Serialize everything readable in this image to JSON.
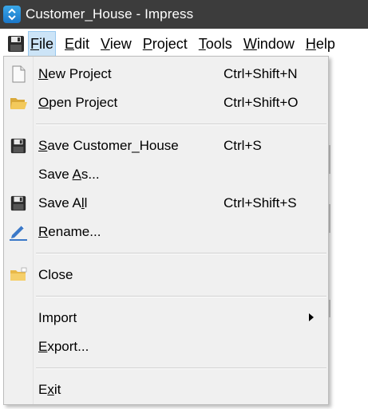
{
  "window": {
    "title": "Customer_House - Impress",
    "app_icon": "impress-app-icon"
  },
  "menubar": {
    "toolbar_icon": "save-icon",
    "items": [
      {
        "label": "File",
        "mnemonic": "F",
        "rest": "ile",
        "active": true
      },
      {
        "label": "Edit",
        "mnemonic": "E",
        "rest": "dit"
      },
      {
        "label": "View",
        "mnemonic": "V",
        "rest": "iew"
      },
      {
        "label": "Project",
        "mnemonic": "P",
        "rest": "roject"
      },
      {
        "label": "Tools",
        "mnemonic": "T",
        "rest": "ools"
      },
      {
        "label": "Window",
        "mnemonic": "W",
        "rest": "indow"
      },
      {
        "label": "Help",
        "mnemonic": "H",
        "rest": "elp"
      }
    ]
  },
  "file_menu": {
    "items": [
      {
        "label": "New Project",
        "pre": "",
        "mn": "N",
        "post": "ew Project",
        "shortcut": "Ctrl+Shift+N",
        "icon": "new-document-icon"
      },
      {
        "label": "Open Project",
        "pre": "",
        "mn": "O",
        "post": "pen Project",
        "shortcut": "Ctrl+Shift+O",
        "icon": "open-folder-icon"
      },
      {
        "label": "Save Customer_House",
        "pre": "",
        "mn": "S",
        "post": "ave Customer_House",
        "shortcut": "Ctrl+S",
        "icon": "save-icon"
      },
      {
        "label": "Save As...",
        "pre": "Save ",
        "mn": "A",
        "post": "s...",
        "shortcut": "",
        "icon": ""
      },
      {
        "label": "Save All",
        "pre": "Save A",
        "mn": "l",
        "post": "l",
        "shortcut": "Ctrl+Shift+S",
        "icon": "save-all-icon"
      },
      {
        "label": "Rename...",
        "pre": "",
        "mn": "R",
        "post": "ename...",
        "shortcut": "",
        "icon": "rename-pen-icon"
      },
      {
        "label": "Close",
        "pre": "",
        "mn": "",
        "post": "Close",
        "shortcut": "",
        "icon": "close-folder-icon"
      },
      {
        "label": "Import",
        "pre": "",
        "mn": "",
        "post": "Import",
        "shortcut": "",
        "icon": "",
        "submenu": true
      },
      {
        "label": "Export...",
        "pre": "",
        "mn": "E",
        "post": "xport...",
        "shortcut": "",
        "icon": ""
      },
      {
        "label": "Exit",
        "pre": "E",
        "mn": "x",
        "post": "it",
        "shortcut": "",
        "icon": ""
      }
    ]
  },
  "colors": {
    "titlebar_bg": "#3c3c3c",
    "menu_active_bg": "#cce4f7",
    "menu_active_border": "#99c9ef",
    "dropdown_bg": "#f0f0f0",
    "app_icon_blue": "#1a76c8"
  }
}
